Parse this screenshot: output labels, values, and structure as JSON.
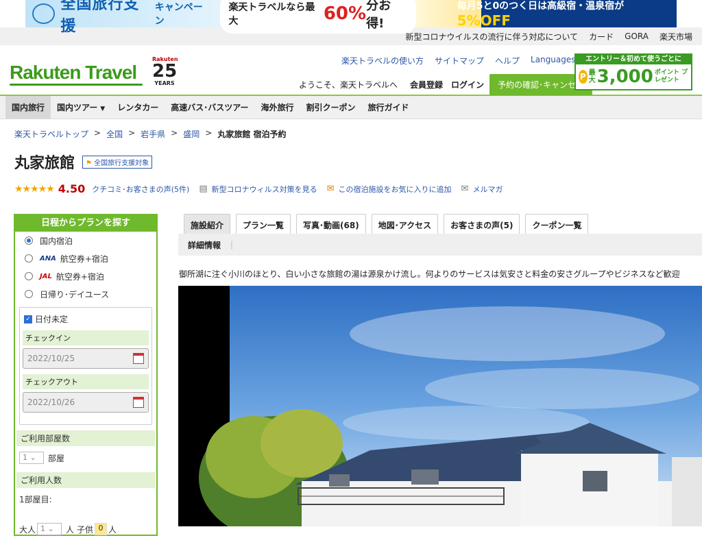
{
  "promo": {
    "title": "全国旅行支援",
    "subtitle": "キャンペーン",
    "mid_text": "楽天トラベルなら最大",
    "mid_pct": "60%",
    "mid_suffix": "分お得!",
    "right_text": "毎月5と0のつく日は高級宿・温泉宿が",
    "right_pct": "5%OFF"
  },
  "util_links": [
    "新型コロナウイルスの流行に伴う対応について",
    "カード",
    "GORA",
    "楽天市場"
  ],
  "header": {
    "logo": "Rakuten Travel",
    "badge": {
      "top": "Rakuten",
      "num": "25",
      "bottom": "YEARS"
    },
    "links": [
      "楽天トラベルの使い方",
      "サイトマップ",
      "ヘルプ"
    ],
    "languages": "Languages",
    "welcome": "ようこそ、楽天トラベルへ",
    "register": "会員登録",
    "login": "ログイン",
    "confirm_button": "予約の確認･キャンセル",
    "entry": {
      "top": "エントリー＆初めて使うごとに",
      "coin": "P",
      "max": "最大",
      "num": "3,000",
      "pt": "ポイント プレゼント"
    }
  },
  "nav": [
    "国内旅行",
    "国内ツアー",
    "レンタカー",
    "高速バス･バスツアー",
    "海外旅行",
    "割引クーポン",
    "旅行ガイド"
  ],
  "breadcrumb": {
    "links": [
      "楽天トラベルトップ",
      "全国",
      "岩手県",
      "盛岡"
    ],
    "separator": ">",
    "current": "丸家旅館 宿泊予約"
  },
  "hotel": {
    "name": "丸家旅館",
    "support_tag": "全国旅行支援対象",
    "stars": "★★★★★",
    "score": "4.50",
    "reviews_link": "クチコミ･お客さまの声(5件)",
    "covid_link": "新型コロナウィルス対策を見る",
    "fav_link": "この宿泊施設をお気に入りに追加",
    "mail_link": "メルマガ",
    "description": "御所湖に注ぐ小川のほとり、白い小さな旅館の湯は源泉かけ流し。何よりのサービスは気安さと料金の安さグループやビジネスなど歓迎"
  },
  "sidebar": {
    "title": "日程からプランを探す",
    "options": [
      {
        "airline": "",
        "label": "国内宿泊"
      },
      {
        "airline": "ANA",
        "label": "航空券+宿泊"
      },
      {
        "airline": "JAL",
        "label": "航空券+宿泊"
      },
      {
        "airline": "",
        "label": "日帰り･デイユース"
      }
    ],
    "date_undecided": "日付未定",
    "checkin_label": "チェックイン",
    "checkin_value": "2022/10/25",
    "checkout_label": "チェックアウト",
    "checkout_value": "2022/10/26",
    "rooms_label": "ご利用部屋数",
    "rooms_value": "1",
    "rooms_unit": "部屋",
    "guests_label": "ご利用人数",
    "room1": "1部屋目:",
    "adult_label": "大人",
    "adult_value": "1",
    "person_unit": "人",
    "child_label": "子供",
    "child_value": "0"
  },
  "tabs": [
    "施設紹介",
    "プラン一覧",
    "写真･動画(68)",
    "地図･アクセス",
    "お客さまの声(5)",
    "クーポン一覧"
  ],
  "subtab": "詳細情報"
}
